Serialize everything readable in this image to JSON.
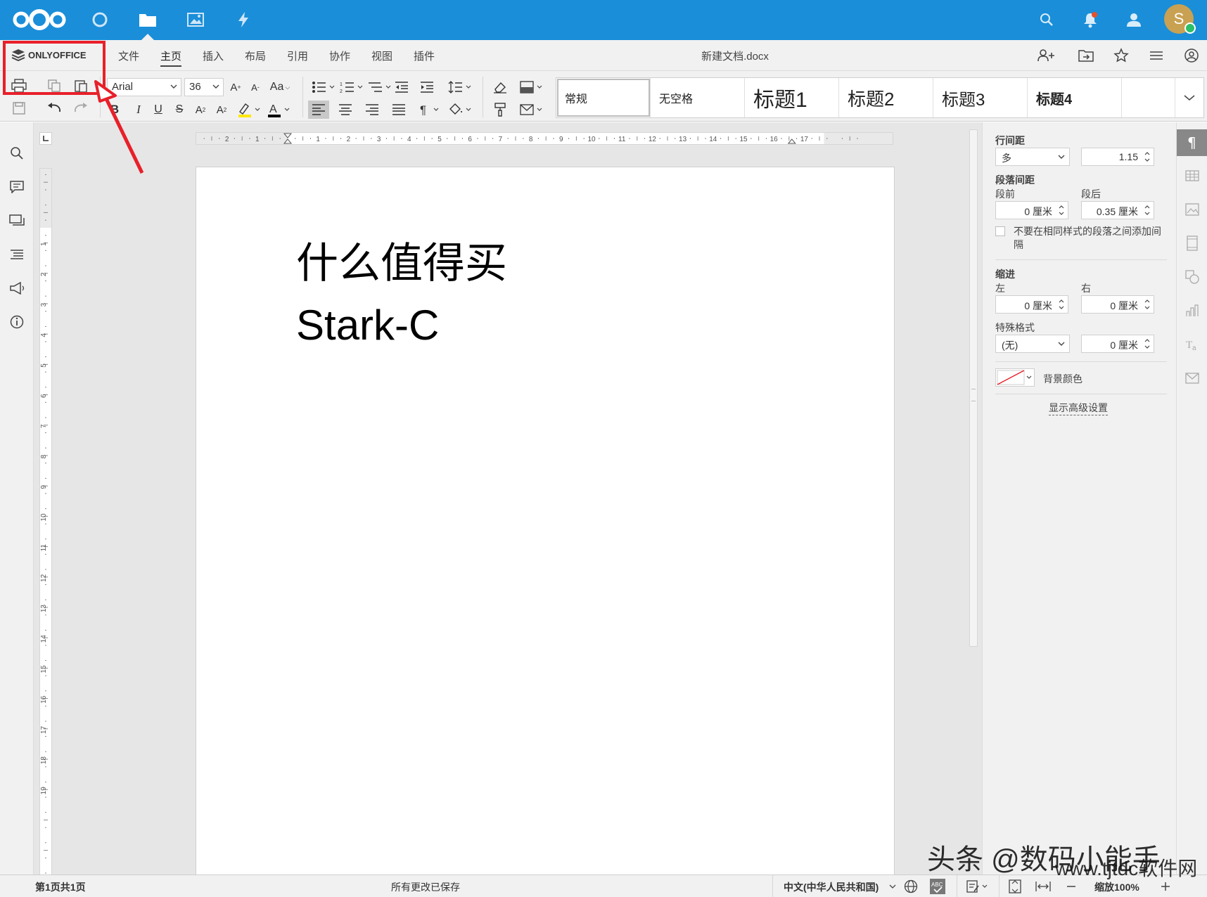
{
  "nextcloud": {
    "apps": [
      "nextcloud-logo-icon",
      "dashboard-icon",
      "files-icon",
      "photos-icon",
      "activity-icon"
    ],
    "avatar_letter": "S",
    "colors": {
      "bar": "#1a8ed9",
      "avatar": "#c9a152",
      "status": "#2bbf6a",
      "notify": "#e8502a"
    }
  },
  "header": {
    "brand": "ONLYOFFICE",
    "tabs": [
      "文件",
      "主页",
      "插入",
      "布局",
      "引用",
      "协作",
      "视图",
      "插件"
    ],
    "active_tab": "主页",
    "doc_title": "新建文档.docx"
  },
  "toolbar": {
    "font_name": "Arial",
    "font_size": "36",
    "styles": [
      {
        "label": "常规"
      },
      {
        "label": "无空格"
      },
      {
        "label": "标题1"
      },
      {
        "label": "标题2"
      },
      {
        "label": "标题3"
      },
      {
        "label": "标题4"
      }
    ]
  },
  "document": {
    "lines": [
      "什么值得买",
      "Stark-C"
    ]
  },
  "ruler": {
    "h_numbers": [
      "2",
      "1",
      "1",
      "2",
      "3",
      "4",
      "5",
      "6",
      "7",
      "8",
      "9",
      "10",
      "11",
      "12",
      "13",
      "14",
      "15",
      "16",
      "17"
    ],
    "v_numbers": [
      "1",
      "2",
      "3",
      "4",
      "5",
      "6",
      "7",
      "8",
      "9",
      "10",
      "11",
      "12",
      "13",
      "14",
      "15",
      "16",
      "17",
      "18",
      "19"
    ]
  },
  "paragraph_panel": {
    "line_spacing_label": "行间距",
    "line_spacing_type": "多",
    "line_spacing_value": "1.15",
    "para_spacing_label": "段落间距",
    "before_label": "段前",
    "after_label": "段后",
    "before_value": "0 厘米",
    "after_value": "0.35 厘米",
    "no_space_checkbox": "不要在相同样式的段落之间添加间隔",
    "indent_label": "缩进",
    "left_label": "左",
    "right_label": "右",
    "left_value": "0 厘米",
    "right_value": "0 厘米",
    "special_label": "特殊格式",
    "special_value": "(无)",
    "special_amount": "0 厘米",
    "bg_color_label": "背景颜色",
    "advanced_link": "显示高级设置"
  },
  "status": {
    "page_info": "第1页共1页",
    "saved": "所有更改已保存",
    "language": "中文(中华人民共和国)",
    "zoom": "缩放100%"
  },
  "watermark": {
    "line1": "头条 @数码小能手",
    "line2": "www.tjtdc软件网"
  }
}
